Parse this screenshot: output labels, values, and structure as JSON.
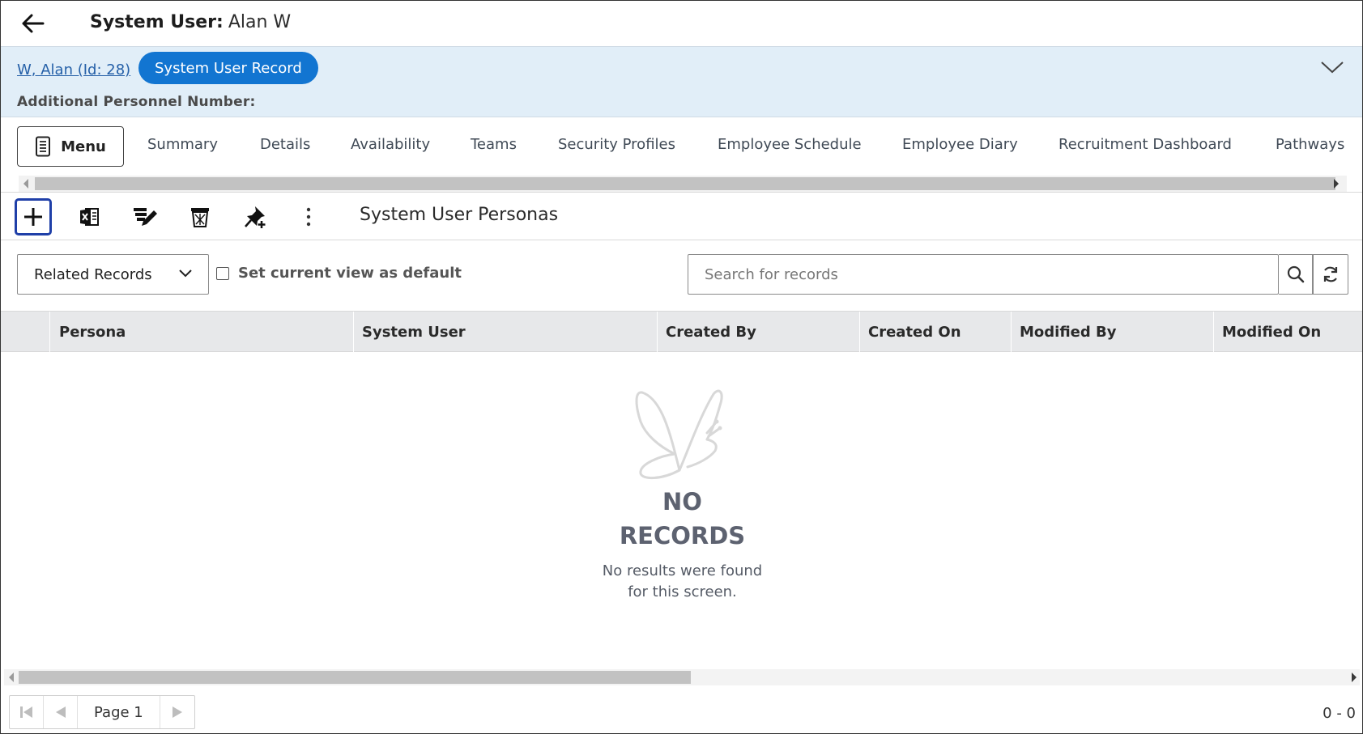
{
  "header": {
    "title_label": "System User:",
    "title_value": "Alan W"
  },
  "record_band": {
    "record_link": "W, Alan (Id: 28)",
    "record_pill": "System User Record",
    "additional_label": "Additional Personnel Number:"
  },
  "tabs": {
    "menu_label": "Menu",
    "items": [
      {
        "label": "Summary"
      },
      {
        "label": "Details"
      },
      {
        "label": "Availability"
      },
      {
        "label": "Teams"
      },
      {
        "label": "Security Profiles"
      },
      {
        "label": "Employee Schedule"
      },
      {
        "label": "Employee Diary"
      },
      {
        "label": "Recruitment Dashboard"
      },
      {
        "label": "Pathways"
      }
    ]
  },
  "toolbar": {
    "section_title": "System User Personas",
    "icons": [
      "add-icon",
      "excel-export-icon",
      "bulk-edit-icon",
      "delete-icon",
      "pin-add-icon",
      "more-vertical-icon"
    ]
  },
  "filters": {
    "view_select": "Related Records",
    "default_checkbox_label": "Set current view as default",
    "search_placeholder": "Search for records"
  },
  "grid": {
    "columns": [
      "Persona",
      "System User",
      "Created By",
      "Created On",
      "Modified By",
      "Modified On"
    ]
  },
  "empty_state": {
    "title_line1": "NO",
    "title_line2": "RECORDS",
    "sub_line1": "No results were found",
    "sub_line2": "for this screen."
  },
  "pager": {
    "page_label": "Page 1",
    "count": "0 - 0"
  },
  "colors": {
    "accent": "#1275d1",
    "band_bg": "#e1eef8",
    "focus_border": "#1f3fa8",
    "link": "#2560a8"
  }
}
